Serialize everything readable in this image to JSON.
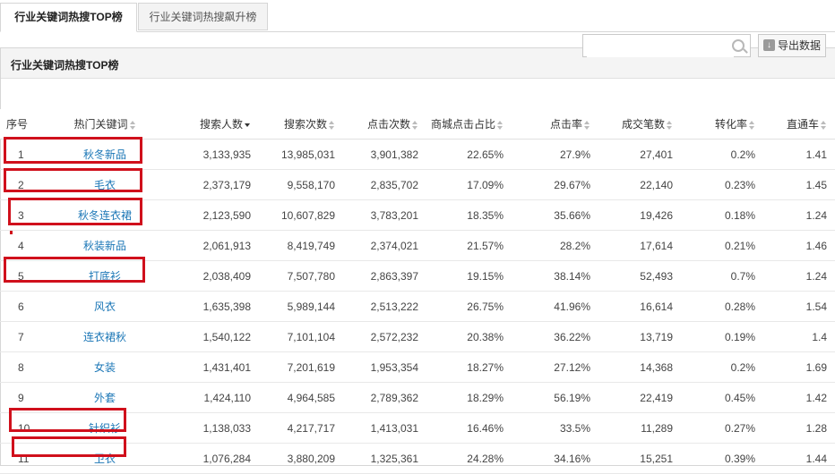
{
  "tabs": [
    {
      "label": "行业关键词热搜TOP榜"
    },
    {
      "label": "行业关键词热搜飙升榜"
    }
  ],
  "panel": {
    "title": "行业关键词热搜TOP榜"
  },
  "search": {
    "placeholder": "",
    "value": "",
    "icon": "search-icon"
  },
  "export": {
    "label": "导出数据",
    "icon": "download-icon"
  },
  "table": {
    "headers": [
      "序号",
      "热门关键词",
      "搜索人数",
      "搜索次数",
      "点击次数",
      "商城点击占比",
      "点击率",
      "成交笔数",
      "转化率",
      "直通车"
    ],
    "rows": [
      {
        "no": "1",
        "kw": "秋冬新品",
        "users": "3,133,935",
        "searches": "13,985,031",
        "clicks": "3,901,382",
        "mall": "22.65%",
        "ctr": "27.9%",
        "deals": "27,401",
        "cvr": "0.2%",
        "ztc": "1.41"
      },
      {
        "no": "2",
        "kw": "毛衣",
        "users": "2,373,179",
        "searches": "9,558,170",
        "clicks": "2,835,702",
        "mall": "17.09%",
        "ctr": "29.67%",
        "deals": "22,140",
        "cvr": "0.23%",
        "ztc": "1.45"
      },
      {
        "no": "3",
        "kw": "秋冬连衣裙",
        "users": "2,123,590",
        "searches": "10,607,829",
        "clicks": "3,783,201",
        "mall": "18.35%",
        "ctr": "35.66%",
        "deals": "19,426",
        "cvr": "0.18%",
        "ztc": "1.24"
      },
      {
        "no": "4",
        "kw": "秋装新品",
        "users": "2,061,913",
        "searches": "8,419,749",
        "clicks": "2,374,021",
        "mall": "21.57%",
        "ctr": "28.2%",
        "deals": "17,614",
        "cvr": "0.21%",
        "ztc": "1.46"
      },
      {
        "no": "5",
        "kw": "打底衫",
        "users": "2,038,409",
        "searches": "7,507,780",
        "clicks": "2,863,397",
        "mall": "19.15%",
        "ctr": "38.14%",
        "deals": "52,493",
        "cvr": "0.7%",
        "ztc": "1.24"
      },
      {
        "no": "6",
        "kw": "风衣",
        "users": "1,635,398",
        "searches": "5,989,144",
        "clicks": "2,513,222",
        "mall": "26.75%",
        "ctr": "41.96%",
        "deals": "16,614",
        "cvr": "0.28%",
        "ztc": "1.54"
      },
      {
        "no": "7",
        "kw": "连衣裙秋",
        "users": "1,540,122",
        "searches": "7,101,104",
        "clicks": "2,572,232",
        "mall": "20.38%",
        "ctr": "36.22%",
        "deals": "13,719",
        "cvr": "0.19%",
        "ztc": "1.4"
      },
      {
        "no": "8",
        "kw": "女装",
        "users": "1,431,401",
        "searches": "7,201,619",
        "clicks": "1,953,354",
        "mall": "18.27%",
        "ctr": "27.12%",
        "deals": "14,368",
        "cvr": "0.2%",
        "ztc": "1.69"
      },
      {
        "no": "9",
        "kw": "外套",
        "users": "1,424,110",
        "searches": "4,964,585",
        "clicks": "2,789,362",
        "mall": "18.29%",
        "ctr": "56.19%",
        "deals": "22,419",
        "cvr": "0.45%",
        "ztc": "1.42"
      },
      {
        "no": "10",
        "kw": "针织衫",
        "users": "1,138,033",
        "searches": "4,217,717",
        "clicks": "1,413,031",
        "mall": "16.46%",
        "ctr": "33.5%",
        "deals": "11,289",
        "cvr": "0.27%",
        "ztc": "1.28"
      },
      {
        "no": "11",
        "kw": "卫衣",
        "users": "1,076,284",
        "searches": "3,880,209",
        "clicks": "1,325,361",
        "mall": "24.28%",
        "ctr": "34.16%",
        "deals": "15,251",
        "cvr": "0.39%",
        "ztc": "1.44"
      }
    ]
  },
  "colors": {
    "keyword_link": "#1a76b6",
    "highlight": "#d0101c",
    "header_bg": "#f4f4f4"
  }
}
